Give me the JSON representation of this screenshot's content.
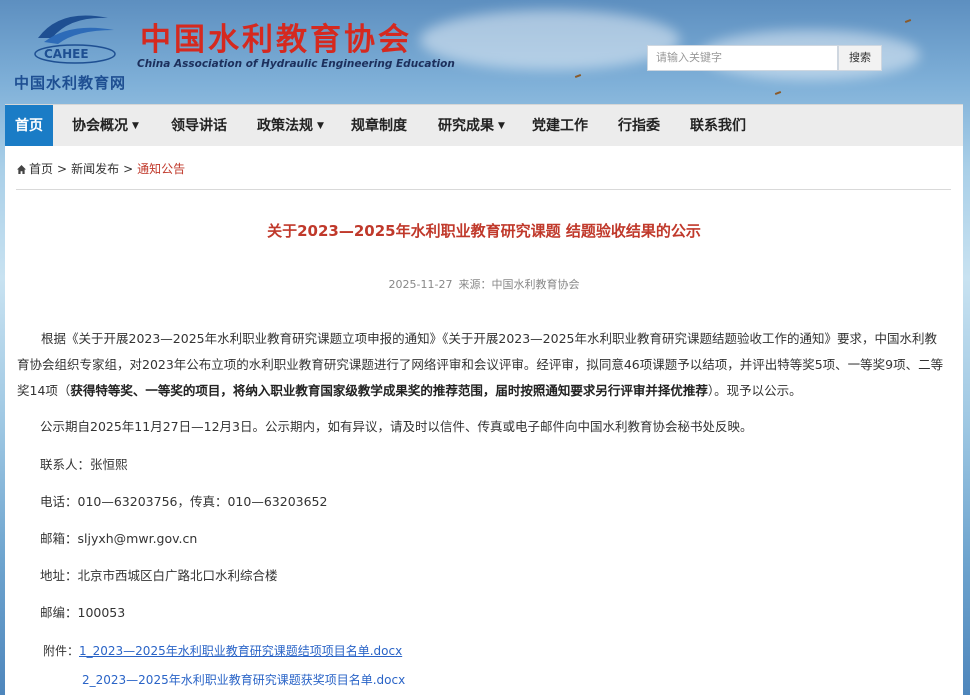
{
  "header": {
    "logo_text": "CAHEE",
    "site_name": "中国水利教育网",
    "org_name_cn": "中国水利教育协会",
    "org_name_en": "China Association of Hydraulic Engineering Education",
    "search_placeholder": "请输入关键字",
    "search_button": "搜索"
  },
  "nav": {
    "items": [
      {
        "label": "首页",
        "active": true,
        "dropdown": false
      },
      {
        "label": "协会概况",
        "dropdown": true
      },
      {
        "label": "领导讲话",
        "dropdown": false
      },
      {
        "label": "政策法规",
        "dropdown": true
      },
      {
        "label": "规章制度",
        "dropdown": false
      },
      {
        "label": "研究成果",
        "dropdown": true
      },
      {
        "label": "党建工作",
        "dropdown": false
      },
      {
        "label": "行指委",
        "dropdown": false
      },
      {
        "label": "联系我们",
        "dropdown": false
      }
    ]
  },
  "breadcrumb": {
    "home": "首页",
    "section": "新闻发布",
    "current": "通知公告",
    "separator": ">"
  },
  "article": {
    "title": "关于2023—2025年水利职业教育研究课题 结题验收结果的公示",
    "date": "2025-11-27",
    "source": "来源：中国水利教育协会",
    "p1_normal": "根据《关于开展2023—2025年水利职业教育研究课题立项申报的通知》《关于开展2023—2025年水利职业教育研究课题结题验收工作的通知》要求，中国水利教育协会组织专家组，对2023年公布立项的水利职业教育研究课题进行了网络评审和会议评审。经评审，拟同意46项课题予以结项，并评出特等奖5项、一等奖9项、二等奖14项（",
    "p1_bold": "获得特等奖、一等奖的项目，将纳入职业教育国家级教学成果奖的推荐范围，届时按照通知要求另行评审并择优推荐",
    "p1_end": "）。现予以公示。",
    "p2": "公示期自2025年11月27日—12月3日。公示期内，如有异议，请及时以信件、传真或电子邮件向中国水利教育协会秘书处反映。",
    "contact": "联系人：张恒熙",
    "phone": "电话：010—63203756，传真：010—63203652",
    "email": "邮箱：sljyxh@mwr.gov.cn",
    "address": "地址：北京市西城区白广路北口水利综合楼",
    "postcode": "邮编：100053",
    "attachments_label": "附件：",
    "attachments": [
      "1_2023—2025年水利职业教育研究课题结项项目名单.docx",
      "2_2023—2025年水利职业教育研究课题获奖项目名单.docx"
    ]
  },
  "colors": {
    "nav_active": "#1a7cc6",
    "title_red": "#c0392b",
    "link_blue": "#2a64c7"
  }
}
